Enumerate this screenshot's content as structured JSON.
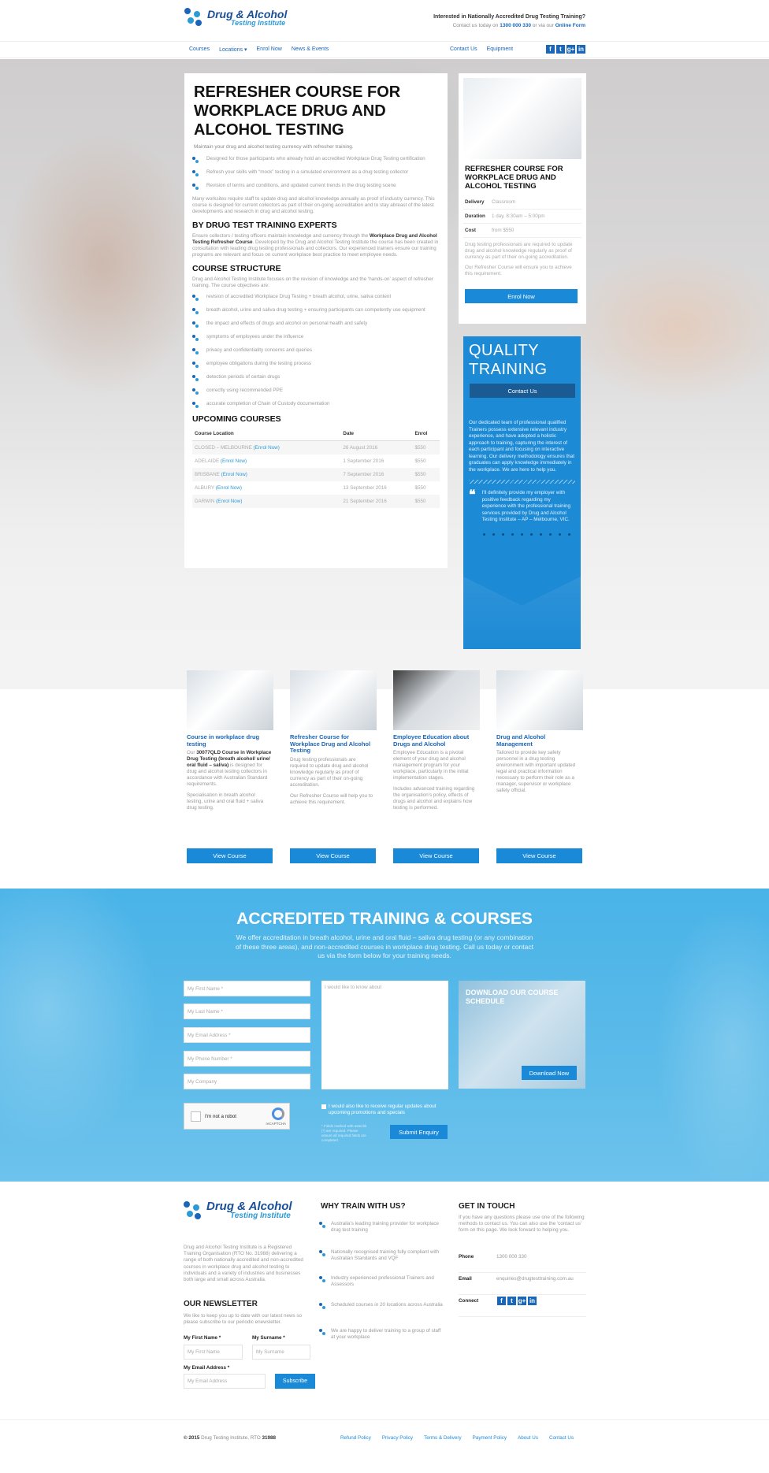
{
  "header": {
    "logo_line1": "Drug & Alcohol",
    "logo_line2": "Testing Institute",
    "question": "Interested in Nationally Accredited Drug Testing Training?",
    "contact_prefix": "Contact us today on",
    "phone": "1300 000 330",
    "contact_mid": "or via our",
    "form_link": "Online Form"
  },
  "nav": {
    "left": [
      "Courses",
      "Locations ▾",
      "Enrol Now",
      "News & Events"
    ],
    "right": [
      "Contact Us",
      "Equipment"
    ],
    "social": [
      {
        "icon": "facebook-icon",
        "glyph": "f"
      },
      {
        "icon": "twitter-icon",
        "glyph": "t"
      },
      {
        "icon": "google-plus-icon",
        "glyph": "g+"
      },
      {
        "icon": "linkedin-icon",
        "glyph": "in"
      }
    ]
  },
  "article": {
    "title": "REFRESHER COURSE FOR WORKPLACE DRUG AND ALCOHOL TESTING",
    "intro": "Maintain your drug and alcohol testing currency with refresher training.",
    "bullets": [
      "Designed for those participants who already hold an accredited Workplace Drug Testing certification",
      "Refresh your skills with “mock” testing in a simulated environment as a drug testing collector",
      "Revision of terms and conditions, and updated current trends in the drug testing scene"
    ],
    "para1": "Many worksites require staff to update drug and alcohol knowledge annually as proof of industry currency. This course is designed for current collectors as part of their on-going accreditation and to stay abreast of the latest developments and research in drug and alcohol testing.",
    "h_experts": "BY DRUG TEST TRAINING EXPERTS",
    "para2_a": "Ensure collectors / testing officers maintain knowledge and currency through the",
    "para2_b": "Workplace Drug and Alcohol Testing Refresher Course",
    "para2_c": ". Developed by the Drug and Alcohol Testing Institute the course has been created in consultation with leading drug testing professionals and collectors. Our experienced trainers ensure our training programs are relevant and focus on current workplace best practice to meet employee needs.",
    "h_structure": "COURSE STRUCTURE",
    "para3": "Drug and Alcohol Testing Institute focuses on the revision of knowledge and the ‘hands-on’ aspect of refresher training. The course objectives are:",
    "objectives": [
      "revision of accredited Workplace Drug Testing + breath alcohol, urine, saliva content",
      "breath alcohol, urine and saliva drug testing + ensuring participants can competently use equipment",
      "the impact and effects of drugs and alcohol on personal health and safety",
      "symptoms of employees under the influence",
      "privacy and confidentiality concerns and queries",
      "employee obligations during the testing process",
      "detection periods of certain drugs",
      "correctly using recommended PPE",
      "accurate completion of Chain of Custody documentation"
    ],
    "h_upcoming": "UPCOMING COURSES",
    "table_headers": [
      "Course Location",
      "Date",
      "Enrol"
    ],
    "table_rows": [
      {
        "loc": "CLOSED – MELBOURNE",
        "enrol": "(Enrol Now)",
        "date": "26 August 2016",
        "price": "$550"
      },
      {
        "loc": "ADELAIDE",
        "enrol": "(Enrol Now)",
        "date": "1 September 2016",
        "price": "$550"
      },
      {
        "loc": "BRISBANE",
        "enrol": "(Enrol Now)",
        "date": "7 September 2016",
        "price": "$550"
      },
      {
        "loc": "ALBURY",
        "enrol": "(Enrol Now)",
        "date": "13 September 2016",
        "price": "$550"
      },
      {
        "loc": "DARWIN",
        "enrol": "(Enrol Now)",
        "date": "21 September 2016",
        "price": "$550"
      }
    ]
  },
  "card": {
    "title": "REFRESHER COURSE FOR WORKPLACE DRUG AND ALCOHOL TESTING",
    "rows": [
      {
        "k": "Delivery",
        "v": "Classroom"
      },
      {
        "k": "Duration",
        "v": "1 day, 8:30am – 5:00pm"
      },
      {
        "k": "Cost",
        "v": "from $550"
      }
    ],
    "p1": "Drug testing professionals are required to update drug and alcohol knowledge regularly as proof of currency as part of their on-going accreditation.",
    "p2": "Our Refresher Course will ensure you to achieve this requirement.",
    "button": "Enrol Now"
  },
  "quality": {
    "title1": "QUALITY",
    "title2": "TRAINING",
    "button": "Contact Us",
    "text": "Our dedicated team of professional qualified Trainers possess extensive relevant industry experience, and have adopted a holistic approach to training, capturing the interest of each participant and focusing on interactive learning. Our delivery methodology ensures that graduates can apply knowledge immediately in the workplace. We are here to help you.",
    "quote": "I'll definitely provide my employer with positive feedback regarding my experience with the professional training services provided by Drug and Alcohol Testing Institute – AP – Melbourne, VIC."
  },
  "courses": [
    {
      "title": "Course in workplace drug testing",
      "p1_a": "Our",
      "p1_b": "30077QLD Course in Workplace Drug Testing (breath alcohol/ urine/ oral fluid – saliva)",
      "p1_c": "is designed for drug and alcohol testing collectors in accordance with Australian Standard requirements.",
      "p2": "Specialisation in breath alcohol testing, urine and oral fluid + saliva drug testing.",
      "button": "View Course"
    },
    {
      "title": "Refresher Course for Workplace Drug and Alcohol Testing",
      "p1_a": "Drug testing professionals are required to update drug and alcohol knowledge regularly as proof of currency as part of their on-going accreditation.",
      "p1_b": "",
      "p1_c": "",
      "p2": "Our Refresher Course will help you to achieve this requirement.",
      "button": "View Course"
    },
    {
      "title": "Employee Education about Drugs and Alcohol",
      "p1_a": "Employee Education is a pivotal element of your drug and alcohol management program for your workplace, particularly in the initial implementation stages.",
      "p1_b": "",
      "p1_c": "",
      "p2": "Includes advanced training regarding the organisation's policy, effects of drugs and alcohol and explains how testing is performed.",
      "button": "View Course"
    },
    {
      "title": "Drug and Alcohol Management",
      "p1_a": "Tailored to provide key safety personnel in a drug testing environment with important updated legal and practical information necessary to perform their role as a manager, supervisor or workplace safety official.",
      "p1_b": "",
      "p1_c": "",
      "p2": "",
      "button": "View Course"
    }
  ],
  "accredited": {
    "title": "ACCREDITED TRAINING & COURSES",
    "sub": "We offer accreditation in breath alcohol, urine and oral fluid – saliva drug testing (or any combination of these three areas), and non-accredited courses in workplace drug testing. Call us today or contact us via the form below for your training needs.",
    "fields": [
      "My First Name *",
      "My Last Name *",
      "My Email Address *",
      "My Phone Number *",
      "My Company"
    ],
    "message": "I would like to know about",
    "download_title": "DOWNLOAD OUR COURSE SCHEDULE",
    "download_button": "Download Now",
    "captcha": "I'm not a robot",
    "captcha_brand": "reCAPTCHA",
    "optin": "I would also like to receive regular updates about upcoming promotions and specials",
    "required_note": "* Fields marked with asterisk (*) are required. Please ensure all required fields are completed.",
    "submit": "Submit Enquiry"
  },
  "footer": {
    "about": "Drug and Alcohol Testing Institute is a Registered Training Organisation (RTO No. 31988) delivering a range of both nationally accredited and non-accredited courses in workplace drug and alcohol testing to individuals and a variety of industries and businesses both large and small across Australia.",
    "newsletter_title": "OUR NEWSLETTER",
    "newsletter_p": "We like to keep you up to date with our latest news so please subscribe to our periodic enewsletter.",
    "first_label": "My First Name *",
    "surname_label": "My Surname *",
    "email_label": "My Email Address *",
    "first_ph": "My First Name",
    "surname_ph": "My Surname",
    "email_ph": "My Email Address",
    "subscribe": "Subscribe",
    "why_title": "WHY TRAIN WITH US?",
    "why": [
      "Australia's leading training provider for workplace drug test training",
      "Nationally recognised training fully compliant with Australian Standards and VQF",
      "Industry experienced professional Trainers and Assessors",
      "Scheduled courses in 20 locations across Australia",
      "We are happy to deliver training to a group of staff at your workplace"
    ],
    "touch_title": "GET IN TOUCH",
    "touch_p": "If you have any questions please use one of the following methods to contact us. You can also use the 'contact us' form on this page. We look forward to helping you.",
    "phone_label": "Phone",
    "phone": "1300 000 330",
    "email_label2": "Email",
    "email": "enquiries@drugtesttraining.com.au",
    "connect_label": "Connect",
    "copy_a": "© 2015",
    "copy_b": "Drug Testing Institute, RTO",
    "copy_rto": "31988",
    "links": [
      "Refund Policy",
      "Privacy Policy",
      "Terms & Delivery",
      "Payment Policy",
      "About Us",
      "Contact Us"
    ]
  }
}
